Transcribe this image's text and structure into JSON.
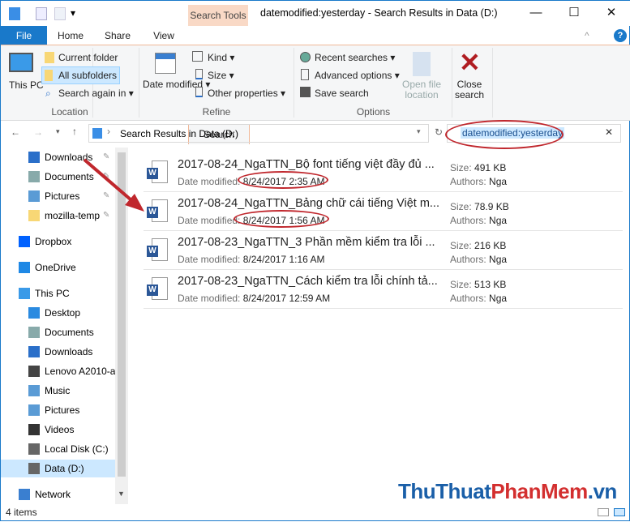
{
  "window": {
    "title": "datemodified:yesterday - Search Results in Data (D:)",
    "context_tab": "Search Tools",
    "minimize": "—",
    "maximize": "☐",
    "close": "✕"
  },
  "tabs": [
    "File",
    "Home",
    "Share",
    "View",
    "Search"
  ],
  "ribbon": {
    "location": {
      "label": "Location",
      "this_pc": "This PC",
      "current_folder": "Current folder",
      "all_subfolders": "All subfolders",
      "search_again": "Search again in"
    },
    "refine": {
      "label": "Refine",
      "date_modified": "Date modified",
      "kind": "Kind",
      "size": "Size",
      "other_properties": "Other properties"
    },
    "options": {
      "label": "Options",
      "recent_searches": "Recent searches",
      "advanced_options": "Advanced options",
      "save_search": "Save search",
      "open_file_location": "Open file location"
    },
    "close_search": "Close search"
  },
  "address": {
    "path": "Search Results in Data (D:)",
    "search_value": "datemodified:yesterday"
  },
  "nav": [
    {
      "label": "Downloads",
      "pinned": true,
      "icon": "download"
    },
    {
      "label": "Documents",
      "pinned": true,
      "icon": "document"
    },
    {
      "label": "Pictures",
      "pinned": true,
      "icon": "picture"
    },
    {
      "label": "mozilla-temp",
      "pinned": true,
      "icon": "folder"
    },
    {
      "label": "Dropbox",
      "icon": "dropbox"
    },
    {
      "label": "OneDrive",
      "icon": "cloud"
    },
    {
      "label": "This PC",
      "icon": "pc"
    },
    {
      "label": "Desktop",
      "icon": "desktop"
    },
    {
      "label": "Documents",
      "icon": "document"
    },
    {
      "label": "Downloads",
      "icon": "download"
    },
    {
      "label": "Lenovo A2010-a",
      "icon": "phone"
    },
    {
      "label": "Music",
      "icon": "music"
    },
    {
      "label": "Pictures",
      "icon": "picture"
    },
    {
      "label": "Videos",
      "icon": "video"
    },
    {
      "label": "Local Disk (C:)",
      "icon": "disk"
    },
    {
      "label": "Data (D:)",
      "icon": "disk",
      "selected": true
    },
    {
      "label": "Network",
      "icon": "network"
    }
  ],
  "results": {
    "date_label": "Date modified:",
    "size_label": "Size:",
    "authors_label": "Authors:",
    "items": [
      {
        "name": "2017-08-24_NgaTTN_Bộ font tiếng việt đầy đủ ...",
        "date": "8/24/2017 2:35 AM",
        "size": "491 KB",
        "author": "Nga"
      },
      {
        "name": "2017-08-24_NgaTTN_Bảng chữ cái tiếng Việt m...",
        "date": "8/24/2017 1:56 AM",
        "size": "78.9 KB",
        "author": "Nga"
      },
      {
        "name": "2017-08-23_NgaTTN_3 Phần mềm kiểm tra lỗi ...",
        "date": "8/24/2017 1:16 AM",
        "size": "216 KB",
        "author": "Nga"
      },
      {
        "name": "2017-08-23_NgaTTN_Cách kiểm tra lỗi chính tả...",
        "date": "8/24/2017 12:59 AM",
        "size": "513 KB",
        "author": "Nga"
      }
    ]
  },
  "status": "4 items",
  "watermark": "ThuThuatPhanMem.vn",
  "colors": {
    "accent": "#1979ca",
    "annotation": "#c0272d"
  }
}
